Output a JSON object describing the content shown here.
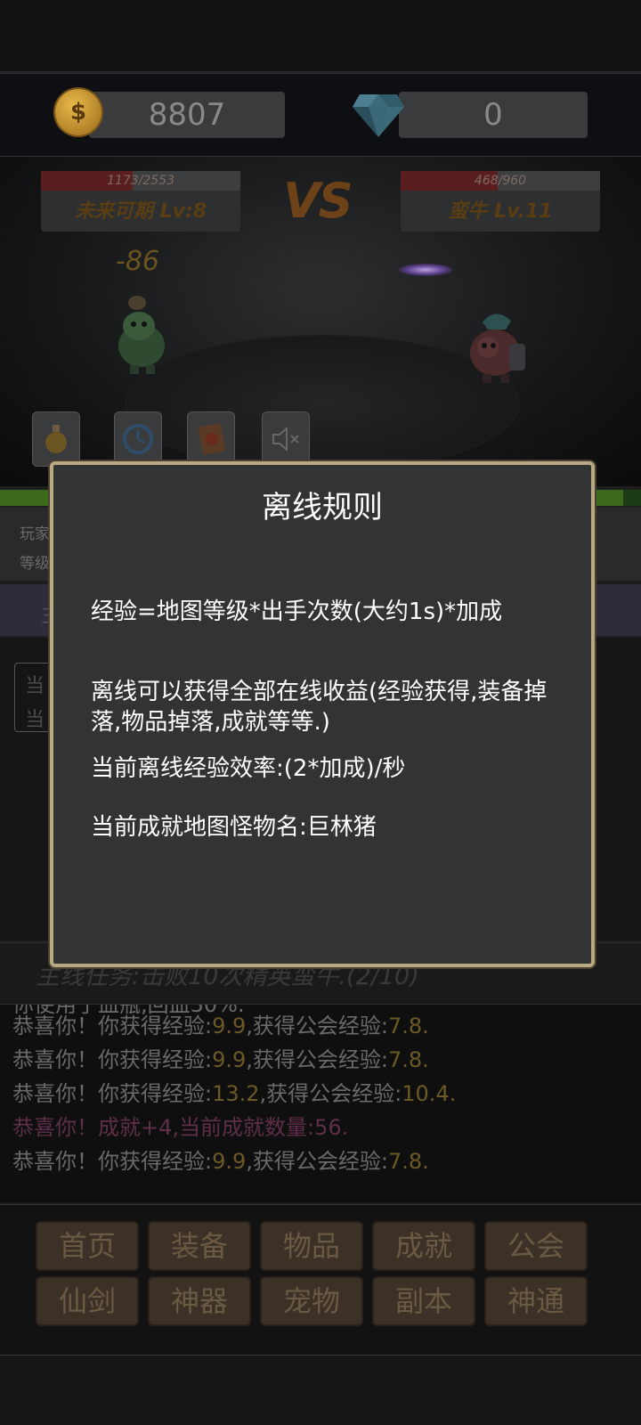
{
  "currency": {
    "coin_symbol": "$",
    "coins": "8807",
    "gems": "0"
  },
  "battle": {
    "player": {
      "hp": "1173/2553",
      "hp_fraction": 0.459,
      "name": "未来可期 Lv:8"
    },
    "enemy": {
      "hp": "468/960",
      "hp_fraction": 0.4875,
      "name": "蛮牛 Lv.11"
    },
    "vs": "VS",
    "damage": "-86",
    "skills": [
      "potion-icon",
      "clock-icon",
      "card-icon",
      "sound-off-icon"
    ]
  },
  "background": {
    "info_line1": "玩家",
    "info_line2": "等级",
    "purple_text": "主",
    "mid_line1": "当",
    "mid_line2": "当"
  },
  "quest": {
    "text": "主线任务:击败10次精英蛮牛.(2/10)"
  },
  "log": [
    {
      "prefix": "恭喜你！你获得经验:",
      "v1": "9.9",
      "mid": ",获得公会经验:",
      "v2": "7.8",
      "suffix": ".",
      "type": "normal"
    },
    {
      "prefix": "恭喜你！你获得经验:",
      "v1": "9.9",
      "mid": ",获得公会经验:",
      "v2": "7.8",
      "suffix": ".",
      "type": "normal"
    },
    {
      "prefix": "恭喜你！你获得经验:",
      "v1": "13.2",
      "mid": ",获得公会经验:",
      "v2": "10.4",
      "suffix": ".",
      "type": "normal"
    },
    {
      "prefix": "恭喜你！成就+4,当前成就数量:",
      "v1": "56",
      "mid": "",
      "v2": "",
      "suffix": ".",
      "type": "achievement"
    },
    {
      "prefix": "恭喜你！你获得经验:",
      "v1": "9.9",
      "mid": ",获得公会经验:",
      "v2": "7.8",
      "suffix": ".",
      "type": "normal"
    }
  ],
  "log_partial_top": "你使用了血瓶,回血30%.",
  "nav": {
    "row1": [
      "首页",
      "装备",
      "物品",
      "成就",
      "公会"
    ],
    "row2": [
      "仙剑",
      "神器",
      "宠物",
      "副本",
      "神通"
    ]
  },
  "modal": {
    "title": "离线规则",
    "line1": "经验=地图等级*出手次数(大约1s)*加成",
    "line2": "离线可以获得全部在线收益(经验获得,装备掉落,物品掉落,成就等等.)",
    "line3": "当前离线经验效率:(2*加成)/秒",
    "line4": "当前成就地图怪物名:巨林猪"
  }
}
